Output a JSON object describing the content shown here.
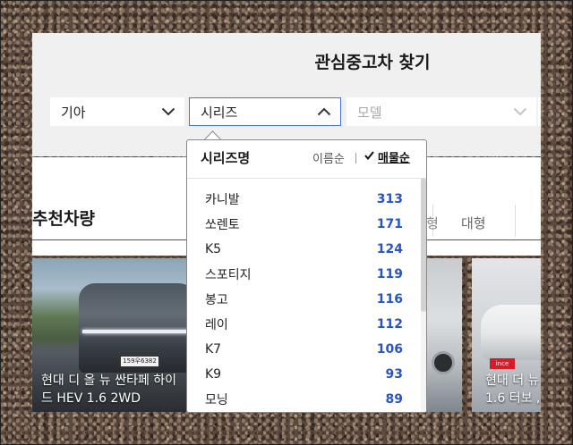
{
  "search_panel": {
    "title": "관심중고차 찾기",
    "maker": {
      "value": "기아"
    },
    "series": {
      "value": "시리즈"
    },
    "model": {
      "placeholder": "모델"
    }
  },
  "series_dropdown": {
    "header": "시리즈명",
    "sort_options": {
      "name_sort": "이름순",
      "sales_sort": "매물순",
      "selected": "매물순"
    },
    "items": [
      {
        "name": "카니발",
        "count": "313"
      },
      {
        "name": "쏘렌토",
        "count": "171"
      },
      {
        "name": "K5",
        "count": "124"
      },
      {
        "name": "스포티지",
        "count": "119"
      },
      {
        "name": "봉고",
        "count": "116"
      },
      {
        "name": "레이",
        "count": "112"
      },
      {
        "name": "K7",
        "count": "106"
      },
      {
        "name": "K9",
        "count": "93"
      },
      {
        "name": "모닝",
        "count": "89"
      }
    ]
  },
  "recommended": {
    "title": "추천차량",
    "tabs": {
      "partial_tab": "형",
      "large_tab": "대형"
    },
    "cards": [
      {
        "caption_line1": "현대 디 올 뉴 싼타페 하이",
        "caption_line2": "드 HEV 1.6 2WD",
        "plate": "159우6382"
      },
      {
        "caption_line1": "",
        "caption_line2": ""
      },
      {
        "caption_line1": "현대 더 뉴",
        "caption_line2": "1.6 터보 ,",
        "badge": "ince"
      }
    ]
  },
  "colors": {
    "accent_blue": "#2a54c4",
    "border_blue": "#4a6edb"
  }
}
